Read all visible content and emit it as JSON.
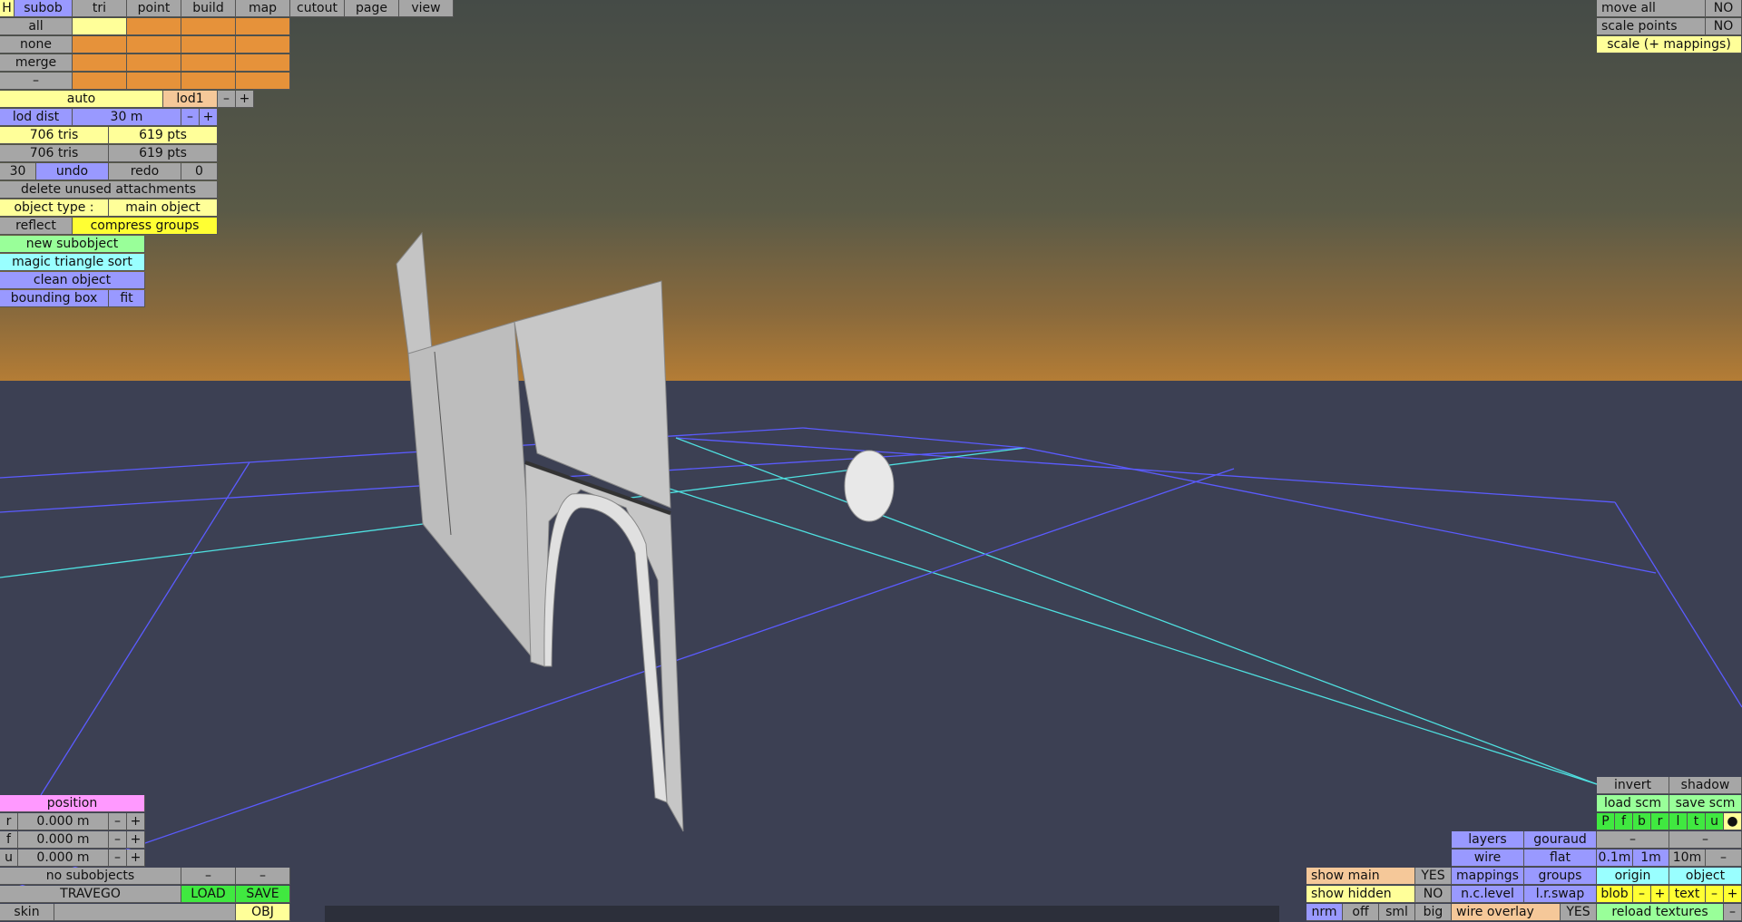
{
  "colors": {
    "accent_blue": "#9999ff",
    "accent_yellow": "#ffff99",
    "accent_green": "#99ff99",
    "accent_cyan": "#99ffff",
    "accent_pink": "#ff99ff",
    "peach": "#f5c899",
    "orange_swatch": "#e6923a",
    "grey": "#a6a6a6",
    "sky_top": "#444a46",
    "horizon": "#b57d35",
    "ground": "#3c4053",
    "grid_blue": "#5b5bff",
    "grid_cyan": "#4fe0e0"
  },
  "toolbar": {
    "mode_h": "H",
    "tabs": [
      "subob",
      "tri",
      "point",
      "build",
      "map",
      "cutout",
      "page",
      "view"
    ]
  },
  "select_rows": [
    "all",
    "none",
    "merge",
    "–"
  ],
  "lod": {
    "auto": "auto",
    "lod1": "lod1",
    "minus": "–",
    "plus": "+",
    "dist_label": "lod dist",
    "dist_value": "30 m"
  },
  "stats": {
    "tris1": "706 tris",
    "pts1": "619 pts",
    "tris2": "706 tris",
    "pts2": "619 pts"
  },
  "history": {
    "count": "30",
    "undo": "undo",
    "redo": "redo",
    "redo_count": "0"
  },
  "actions": {
    "delete_unused": "delete unused attachments",
    "object_type_label": "object type :",
    "object_type_value": "main object",
    "reflect": "reflect",
    "compress": "compress groups",
    "new_subobject": "new subobject",
    "magic_sort": "magic triangle sort",
    "clean_object": "clean object",
    "bounding_box": "bounding box",
    "fit": "fit"
  },
  "position": {
    "title": "position",
    "rows": [
      {
        "axis": "r",
        "value": "0.000 m"
      },
      {
        "axis": "f",
        "value": "0.000 m"
      },
      {
        "axis": "u",
        "value": "0.000 m"
      }
    ],
    "minus": "–",
    "plus": "+"
  },
  "file": {
    "no_subobjects": "no subobjects",
    "dash1": "–",
    "dash2": "–",
    "name": "TRAVEGO",
    "load": "LOAD",
    "save": "SAVE",
    "skin": "skin",
    "skin_value": "",
    "obj": "OBJ"
  },
  "top_right": {
    "move_all": "move all",
    "move_all_val": "NO",
    "scale_points": "scale points",
    "scale_points_val": "NO",
    "scale_mappings": "scale (+ mappings)"
  },
  "bottom_right": {
    "invert": "invert",
    "shadow": "shadow",
    "load_scm": "load scm",
    "save_scm": "save scm",
    "dirs": [
      "P",
      "f",
      "b",
      "r",
      "l",
      "t",
      "u",
      "●"
    ],
    "layers": "layers",
    "gouraud": "gouraud",
    "dash_a": "–",
    "dash_b": "–",
    "wire": "wire",
    "flat": "flat",
    "g01": "0.1m",
    "g1": "1m",
    "g10": "10m",
    "gminus": "–",
    "show_main": "show main",
    "show_main_val": "YES",
    "mappings": "mappings",
    "groups": "groups",
    "origin": "origin",
    "object": "object",
    "show_hidden": "show hidden",
    "show_hidden_val": "NO",
    "nclevel": "n.c.level",
    "lrswap": "l.r.swap",
    "blob": "blob",
    "blob_minus": "–",
    "blob_plus": "+",
    "text": "text",
    "text_minus": "–",
    "text_plus": "+",
    "nrm": "nrm",
    "off": "off",
    "sml": "sml",
    "big": "big",
    "wire_overlay": "wire overlay",
    "wire_overlay_val": "YES",
    "reload": "reload textures",
    "reload_minus": "–"
  }
}
